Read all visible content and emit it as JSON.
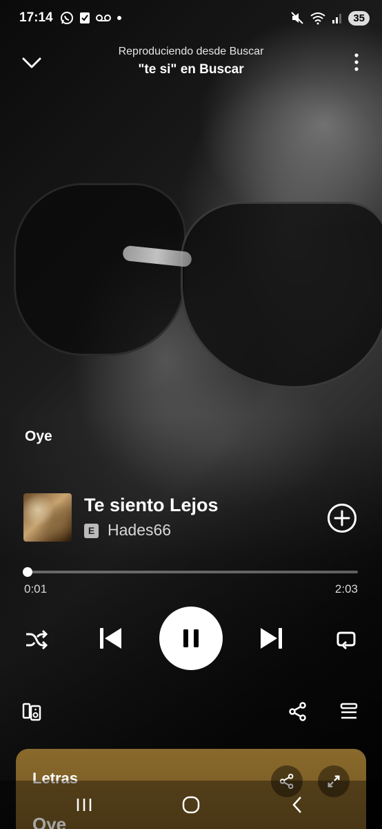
{
  "status_bar": {
    "time": "17:14",
    "battery": "35",
    "icons": [
      "whatsapp-icon",
      "checkbox-icon",
      "voicemail-icon",
      "dot-icon",
      "mute-icon",
      "wifi-icon",
      "signal-icon"
    ]
  },
  "header": {
    "context_label": "Reproduciendo desde Buscar",
    "source": "\"te si\" en Buscar"
  },
  "artwork_caption": "Oye",
  "track": {
    "title": "Te siento Lejos",
    "explicit_badge": "E",
    "artist": "Hades66"
  },
  "playback": {
    "current_time": "0:01",
    "duration": "2:03",
    "progress_fraction": 0.008
  },
  "lyrics": {
    "title": "Letras",
    "first_line": "Oye"
  },
  "colors": {
    "lyrics_card": "#7a5c24",
    "accent": "#ffffff"
  }
}
